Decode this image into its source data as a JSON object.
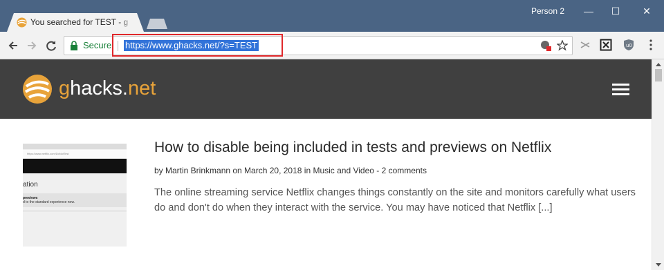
{
  "browser": {
    "tab_title": "You searched for TEST - g",
    "profile": "Person 2",
    "window_controls": {
      "minimize": "—",
      "maximize": "☐",
      "close": "✕"
    },
    "security_label": "Secure",
    "url": "https://www.ghacks.net/?s=TEST",
    "colors": {
      "titlebar": "#4a6484",
      "highlight": "#e0282b",
      "selection": "#3273d9"
    }
  },
  "site": {
    "brand_g": "g",
    "brand_hacks": "hacks",
    "brand_dot": ".",
    "brand_net": "net",
    "accent": "#e8a33a"
  },
  "post": {
    "title": "How to disable being included in tests and previews on Netflix",
    "meta": "by Martin Brinkmann on March 20, 2018 in Music and Video - 2 comments",
    "excerpt": "The online streaming service Netflix changes things constantly on the site and monitors carefully what users do and don't do when they interact with the service. You may have noticed that Netflix [...]",
    "thumbnail_texts": {
      "heading": "ation",
      "line1": "previews",
      "line2": "d to the standard experience now.",
      "url": "https://www.netflix.com/DoNotTest"
    }
  }
}
